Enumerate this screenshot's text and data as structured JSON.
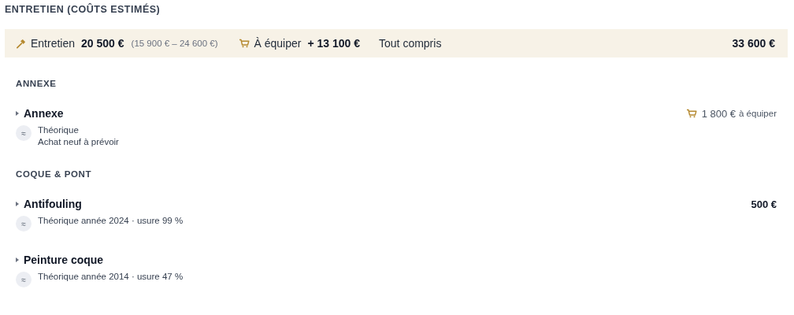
{
  "title": "ENTRETIEN (COÛTS ESTIMÉS)",
  "summary": {
    "maintenance_label": "Entretien",
    "maintenance_amount": "20 500 €",
    "maintenance_range": "(15 900 € – 24 600 €)",
    "equip_label": "À équiper",
    "equip_amount": "+ 13 100 €",
    "total_label": "Tout compris",
    "total_amount": "33 600 €"
  },
  "sections": [
    {
      "heading": "ANNEXE",
      "items": [
        {
          "name": "Annexe",
          "estimate_mark": "≈",
          "lines": [
            "Théorique",
            "Achat neuf à prévoir"
          ],
          "cost": {
            "kind": "equip",
            "amount": "1 800 €",
            "note": "à équiper"
          }
        }
      ]
    },
    {
      "heading": "COQUE & PONT",
      "items": [
        {
          "name": "Antifouling",
          "estimate_mark": "≈",
          "lines": [
            "Théorique année 2024 · usure 99 %"
          ],
          "cost": {
            "kind": "cost",
            "amount": "500 €"
          }
        },
        {
          "name": "Peinture coque",
          "estimate_mark": "≈",
          "lines": [
            "Théorique année 2014 · usure 47 %"
          ]
        }
      ]
    }
  ]
}
